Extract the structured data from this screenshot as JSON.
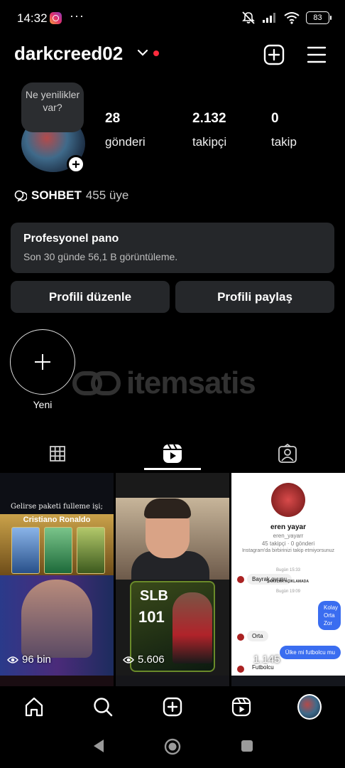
{
  "status_bar": {
    "time": "14:32",
    "dots": "···",
    "battery": "83"
  },
  "header": {
    "username": "darkcreed02",
    "new_dot_color": "#ff2b3d"
  },
  "profile": {
    "note": "Ne yenilikler var?",
    "stats": [
      {
        "value": "28",
        "label": "gönderi"
      },
      {
        "value": "2.132",
        "label": "takipçi"
      },
      {
        "value": "0",
        "label": "takip"
      }
    ],
    "channel": {
      "name": "SOHBET",
      "members": "455 üye"
    }
  },
  "pro_dashboard": {
    "title": "Profesyonel pano",
    "subtitle": "Son 30 günde 56,1 B görüntüleme."
  },
  "buttons": {
    "edit_profile": "Profili düzenle",
    "share_profile": "Profili paylaş"
  },
  "highlights": {
    "new_label": "Yeni"
  },
  "watermark": {
    "text": "itemsatis"
  },
  "tabs": [
    "grid-icon",
    "reels-icon",
    "tagged-icon"
  ],
  "grid": {
    "items": [
      {
        "views": "96 bin",
        "caption": "Gelirse paketi fulleme işi;",
        "title": "Cristiano Ronaldo"
      },
      {
        "views": "5.606",
        "card_top": "SLB",
        "card_rating": "101"
      },
      {
        "views": "1.145",
        "dm": {
          "name": "eren yayar",
          "handle": "eren_yayarr",
          "stats": "45 takipçi · 0 gönderi",
          "info": "Instagram'da birbirinizi takip etmiyorsunuz",
          "time1": "Bugün 15:33",
          "msg1": "Bayrak oyunu",
          "note": "ŞARTLAR AÇIKLAMADA",
          "time2": "Bugün 19:09",
          "msg2": "Kolay Orta Zor",
          "msg3": "Orta",
          "msg4": "Ülke mi futbolcu mu",
          "msg5": "Futbolcu"
        }
      }
    ]
  },
  "bottom_nav": [
    "home-icon",
    "search-icon",
    "create-icon",
    "reels-icon",
    "profile-avatar"
  ],
  "colors": {
    "background": "#000000",
    "panel": "#25272a",
    "accent_red": "#ff2b3d",
    "dm_blue": "#3a6df0"
  }
}
